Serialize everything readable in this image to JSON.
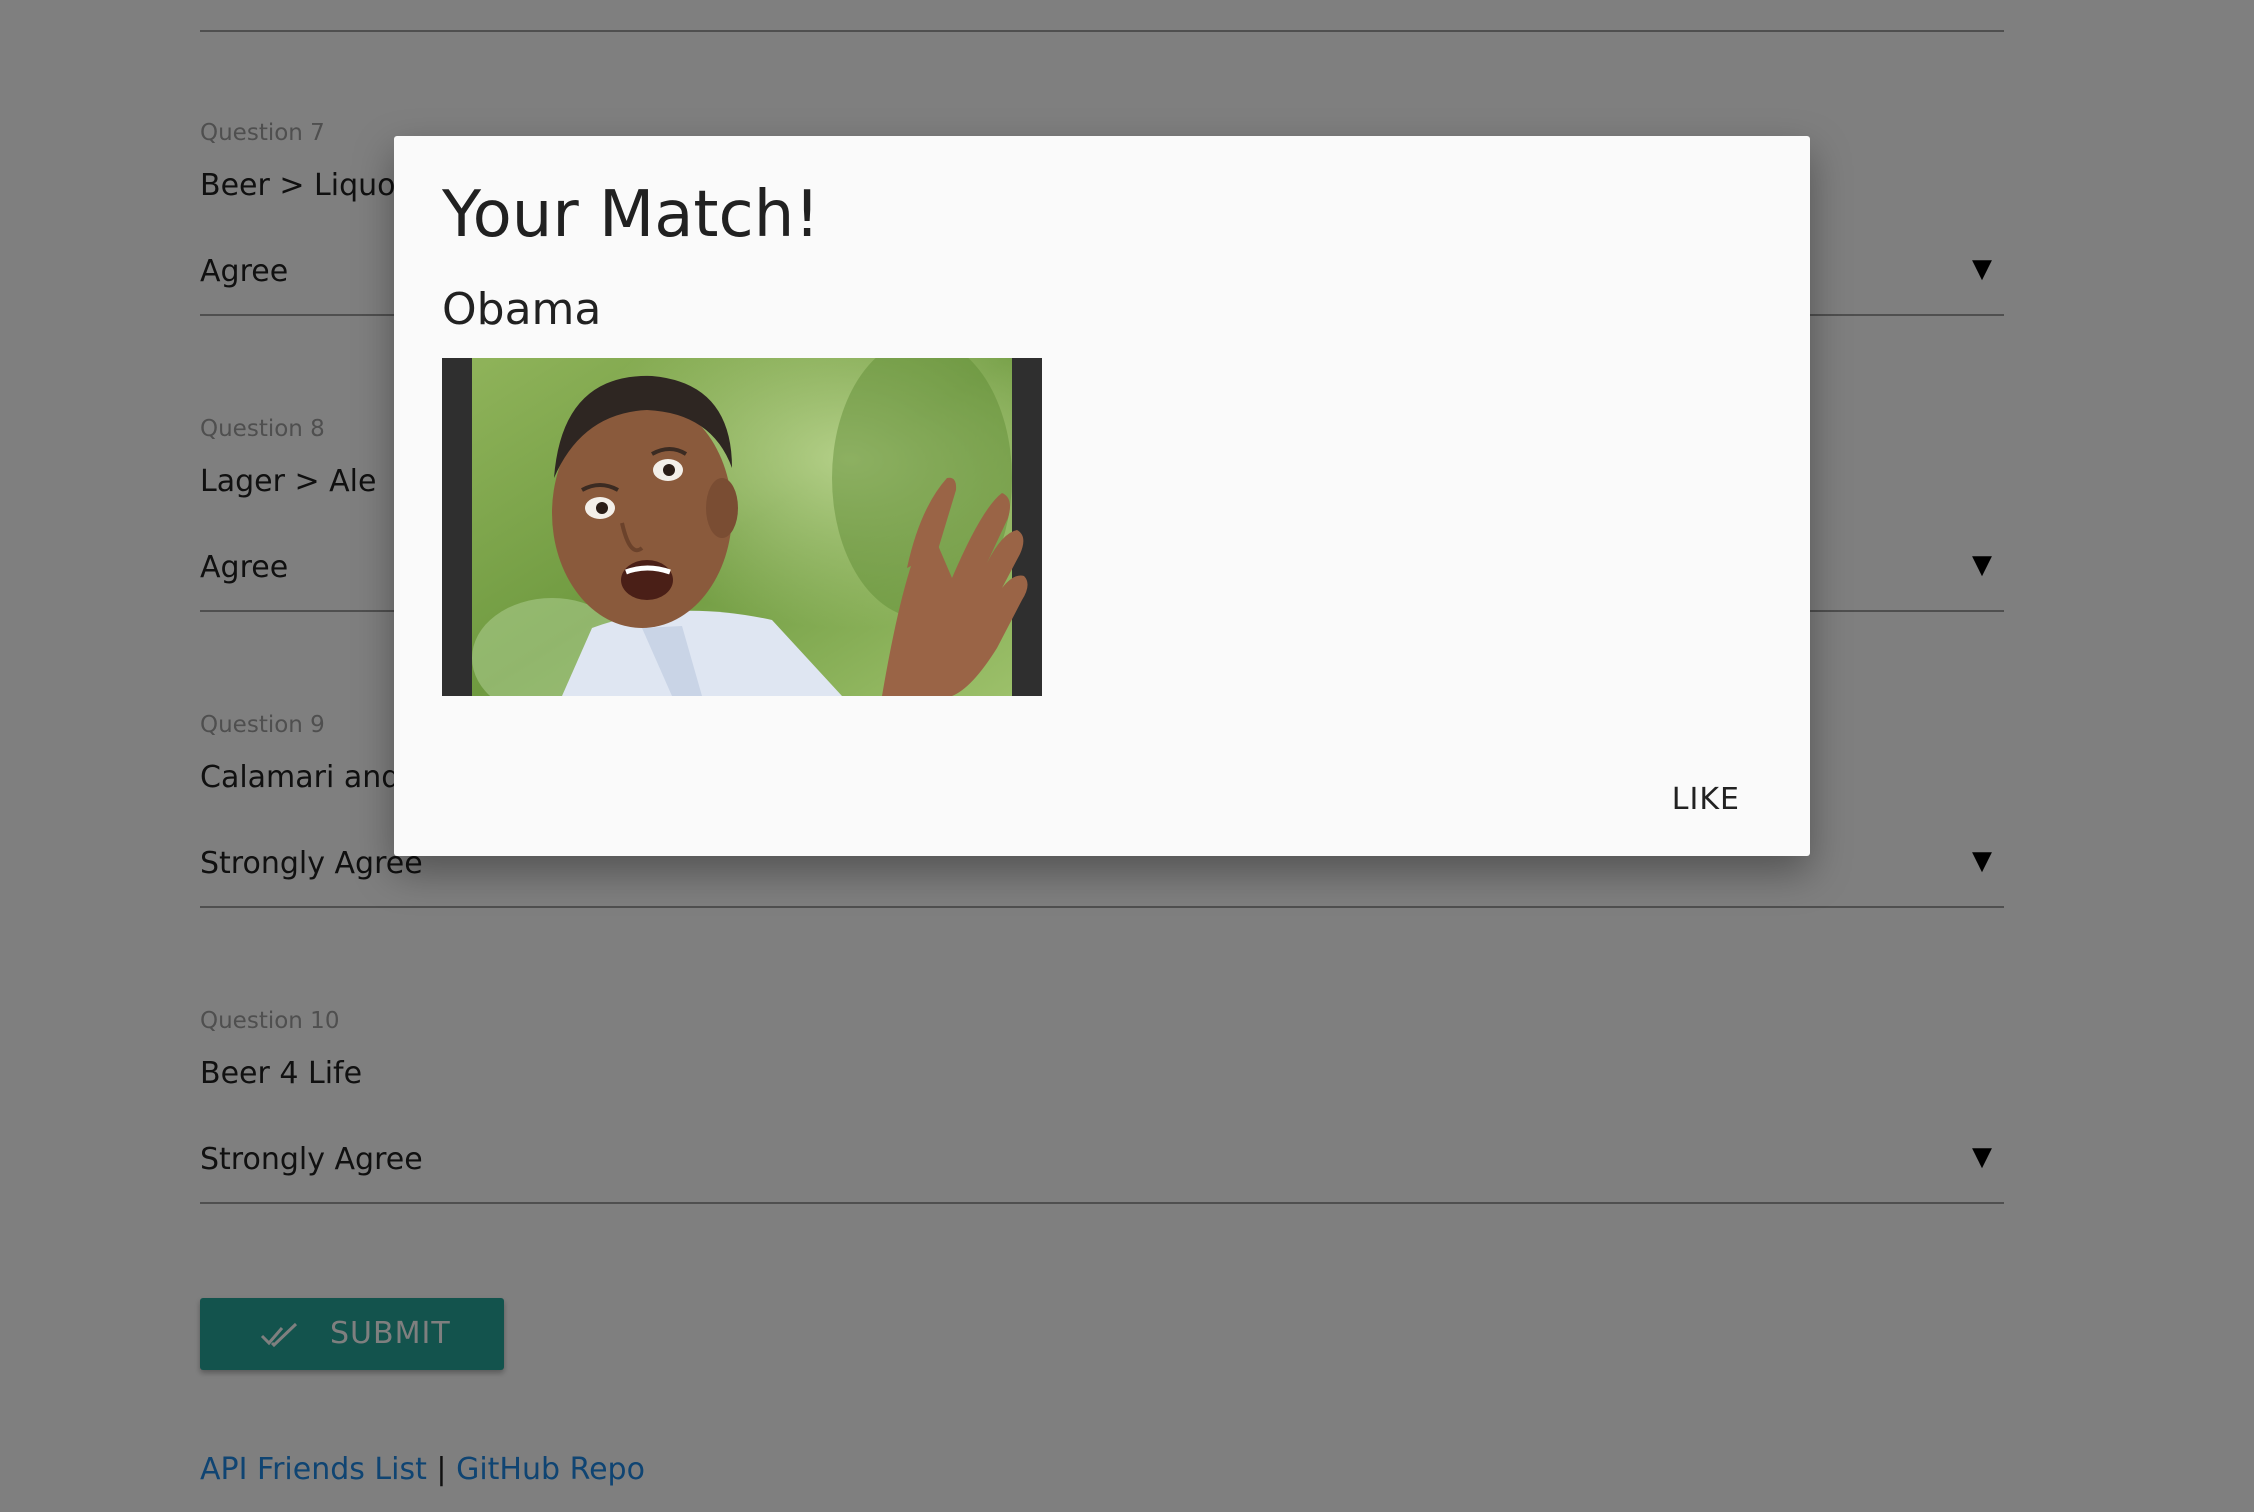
{
  "questions": [
    {
      "label": "Question 7",
      "text": "Beer > Liquor",
      "answer": "Agree"
    },
    {
      "label": "Question 8",
      "text": "Lager > Ale",
      "answer": "Agree"
    },
    {
      "label": "Question 9",
      "text": "Calamari and B",
      "answer": "Strongly Agree"
    },
    {
      "label": "Question 10",
      "text": "Beer 4 Life",
      "answer": "Strongly Agree"
    }
  ],
  "dropdown_arrow": "▼",
  "submit": {
    "label": "SUBMIT",
    "icon": "double-check-icon"
  },
  "footer": {
    "link1": "API Friends List",
    "separator": "|",
    "link2": "GitHub Repo"
  },
  "modal": {
    "title": "Your Match!",
    "name": "Obama",
    "like_label": "LIKE"
  },
  "colors": {
    "accent": "#26a69a",
    "link": "#1e88e5",
    "overlay": "rgba(0,0,0,0.5)"
  }
}
